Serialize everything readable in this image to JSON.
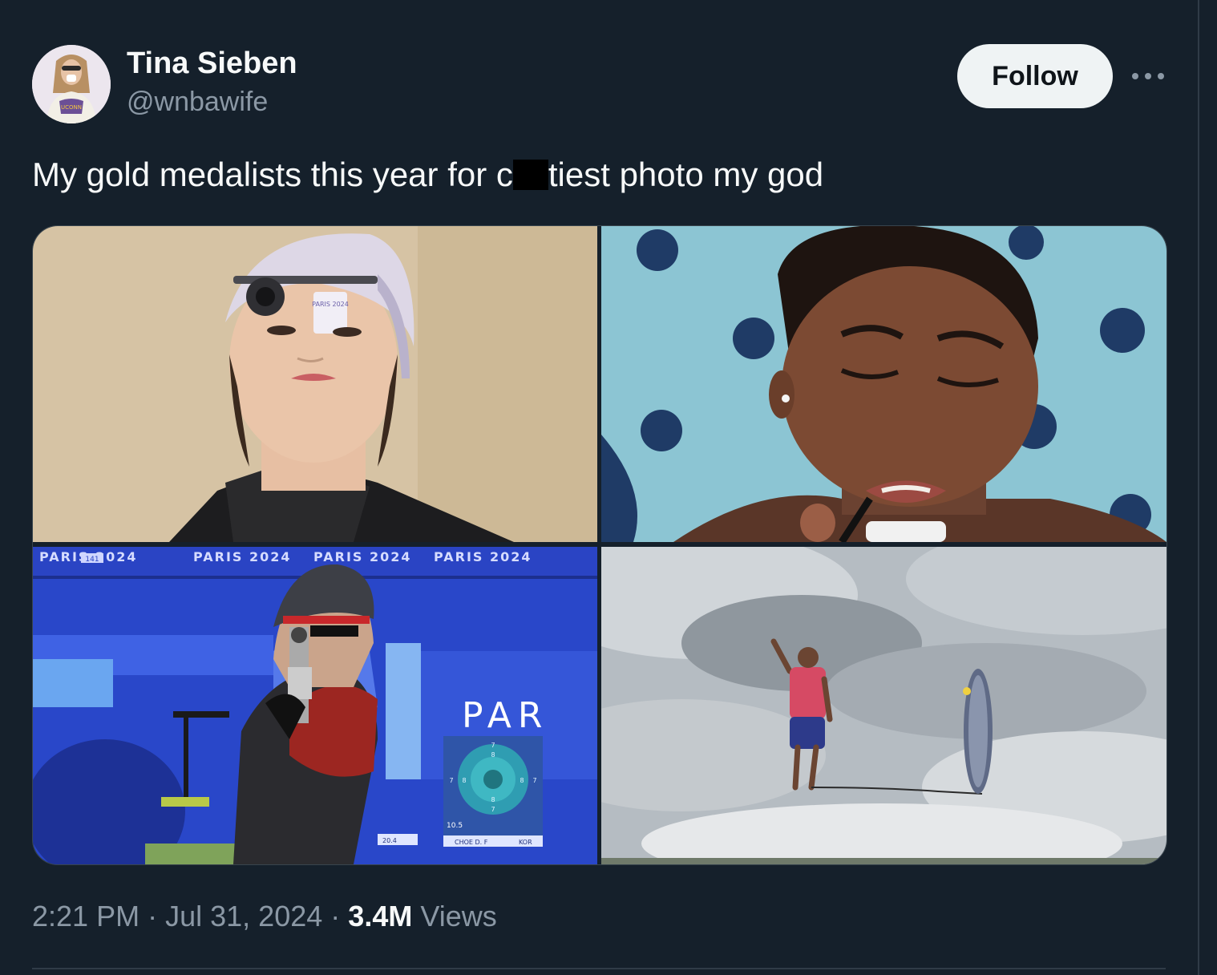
{
  "author": {
    "name": "Tina Sieben",
    "handle": "@wnbawife"
  },
  "actions": {
    "follow_label": "Follow",
    "more_label": "···"
  },
  "tweet": {
    "text_before": "My gold medalists this year for c",
    "text_after": "tiest photo my god"
  },
  "media": {
    "photo1": {
      "cap_text": "PARIS 2024"
    },
    "photo3": {
      "banner_text": "PARIS 2024",
      "bib": "141",
      "board_text": "PAR",
      "score_left": "20.4",
      "score_target": "10.5",
      "athlete_tag": "CHOE D. F",
      "country": "KOR",
      "target_rings": [
        "7",
        "8",
        "8",
        "7",
        "7",
        "8",
        "8",
        "7"
      ]
    }
  },
  "meta": {
    "time": "2:21 PM",
    "date": "Jul 31, 2024",
    "views_count": "3.4M",
    "views_label": "Views",
    "separator": "·"
  }
}
